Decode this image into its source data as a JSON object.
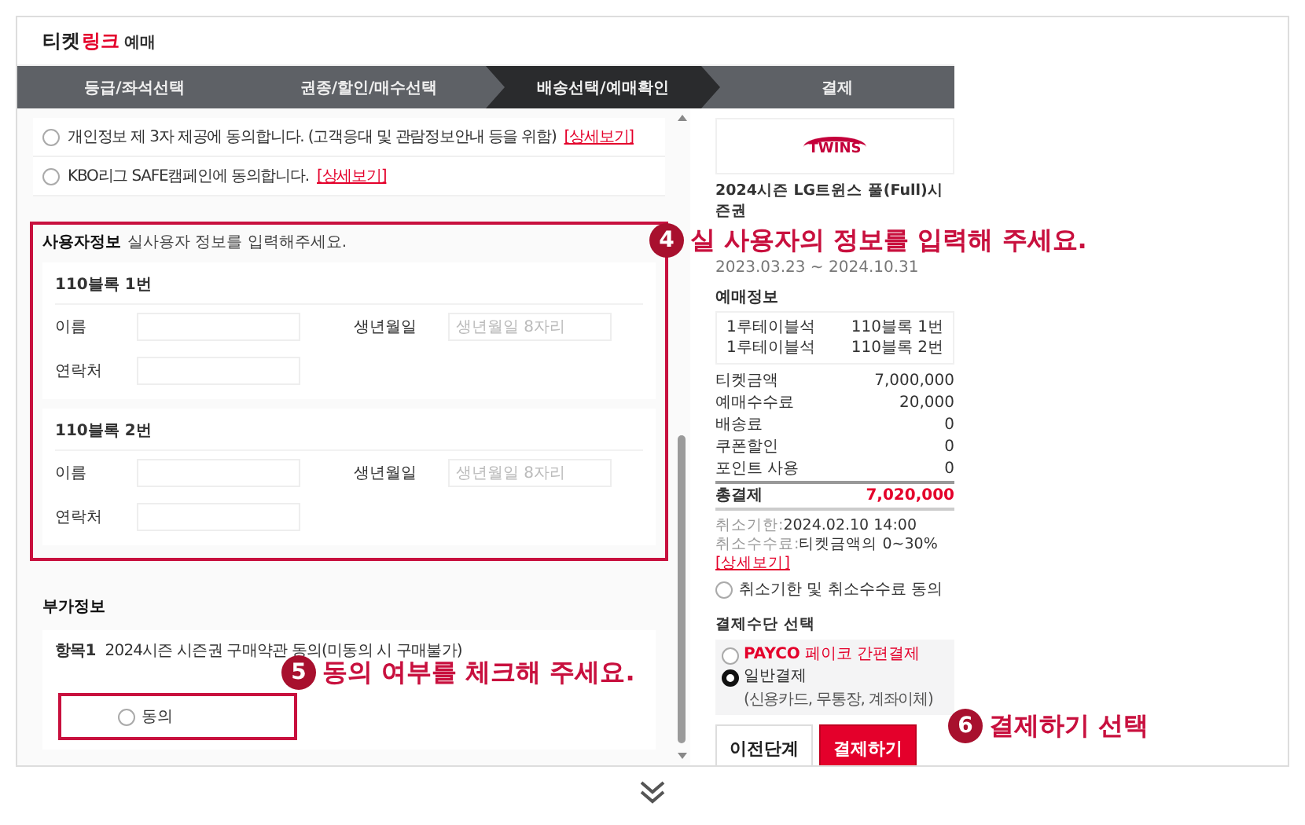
{
  "logo": {
    "dark": "티켓",
    "accent": "링크",
    "suffix": "예매"
  },
  "steps": [
    {
      "label": "등급/좌석선택",
      "selected": false
    },
    {
      "label": "권종/할인/매수선택",
      "selected": false
    },
    {
      "label": "배송선택/예매확인",
      "selected": true
    },
    {
      "label": "결제",
      "selected": false
    }
  ],
  "agreements": [
    {
      "text": "개인정보 제 3자 제공에 동의합니다. (고객응대 및 관람정보안내 등을 위함)",
      "link": "[상세보기]",
      "checked": false
    },
    {
      "text": "KBO리그 SAFE캠페인에 동의합니다.",
      "link": "[상세보기]",
      "checked": false
    }
  ],
  "user_info": {
    "title": "사용자정보",
    "subtitle": "실사용자 정보를 입력해주세요.",
    "blocks": [
      {
        "title": "110블록 1번",
        "name_label": "이름",
        "birth_label": "생년월일",
        "birth_placeholder": "생년월일 8자리",
        "phone_label": "연락처"
      },
      {
        "title": "110블록 2번",
        "name_label": "이름",
        "birth_label": "생년월일",
        "birth_placeholder": "생년월일 8자리",
        "phone_label": "연락처"
      }
    ]
  },
  "extra_info": {
    "title": "부가정보",
    "item_label": "항목1",
    "item_text": "2024시즌 시즌권 구매약관 동의(미동의 시 구매불가)",
    "option": "동의",
    "checked": false
  },
  "summary": {
    "team_logo": "TWINS",
    "title": "2024시즌 LG트윈스 풀(Full)시즌권",
    "period": "2023.03.23 ~ 2024.10.31",
    "booking_title": "예매정보",
    "seats": [
      {
        "grade": "1루테이블석",
        "seat": "110블록 1번"
      },
      {
        "grade": "1루테이블석",
        "seat": "110블록 2번"
      }
    ],
    "prices": [
      {
        "label": "티켓금액",
        "value": "7,000,000",
        "kind": "normal"
      },
      {
        "label": "예매수수료",
        "value": "20,000",
        "kind": "normal"
      },
      {
        "label": "배송료",
        "value": "0",
        "kind": "normal"
      },
      {
        "label": "쿠폰할인",
        "value": "0",
        "kind": "normal"
      },
      {
        "label": "포인트 사용",
        "value": "0",
        "kind": "normal"
      },
      {
        "label": "총결제",
        "value": "7,020,000",
        "kind": "total"
      }
    ],
    "cancel_deadline_label": "취소기한:",
    "cancel_deadline": "2024.02.10 14:00",
    "cancel_fee_label": "취소수수료:",
    "cancel_fee": "티켓금액의 0~30%",
    "cancel_fee_link": "[상세보기]",
    "cancel_agree": {
      "label": "취소기한 및 취소수수료 동의",
      "checked": false
    },
    "payment_title": "결제수단 선택",
    "payment_options": [
      {
        "brand": "PAYCO",
        "label": "페이코 간편결제",
        "kind": "payco",
        "selected": false
      },
      {
        "label": "일반결제",
        "note": "(신용카드, 무통장, 계좌이체)",
        "kind": "general",
        "selected": true
      }
    ],
    "buttons": [
      {
        "label": "이전단계",
        "kind": "secondary"
      },
      {
        "label": "결제하기",
        "kind": "primary"
      }
    ]
  },
  "annotations": [
    {
      "number": "4",
      "text": "실 사용자의 정보를 입력해 주세요.",
      "kind": "boxed"
    },
    {
      "number": "5",
      "text": "동의 여부를 체크해 주세요.",
      "kind": "boxed"
    },
    {
      "number": "6",
      "text": "결제하기 선택",
      "kind": "plain"
    }
  ]
}
